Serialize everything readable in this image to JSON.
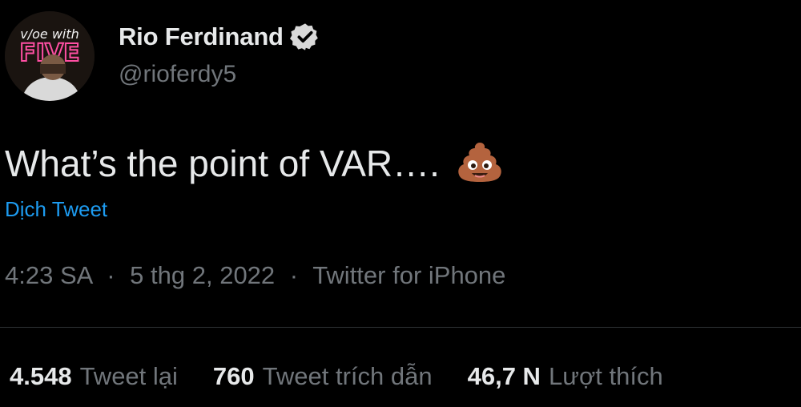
{
  "author": {
    "display_name": "Rio Ferdinand",
    "handle": "@rioferdy5",
    "verified_icon": "verified-badge-icon",
    "avatar": "avatar-photo"
  },
  "tweet": {
    "text": "What’s the point of VAR….",
    "emoji_icon": "pile-of-poo-emoji-icon"
  },
  "translate_label": "Dịch Tweet",
  "meta": {
    "time": "4:23 SA",
    "separator": "·",
    "date": "5 thg 2, 2022",
    "source": "Twitter for iPhone"
  },
  "stats": [
    {
      "value": "4.548",
      "label": "Tweet lại"
    },
    {
      "value": "760",
      "label": "Tweet trích dẫn"
    },
    {
      "value": "46,7 N",
      "label": "Lượt thích"
    }
  ],
  "colors": {
    "background": "#000000",
    "primary_text": "#e7e9ea",
    "secondary_text": "#71767b",
    "link": "#1d9bf0",
    "divider": "#2f3336"
  }
}
